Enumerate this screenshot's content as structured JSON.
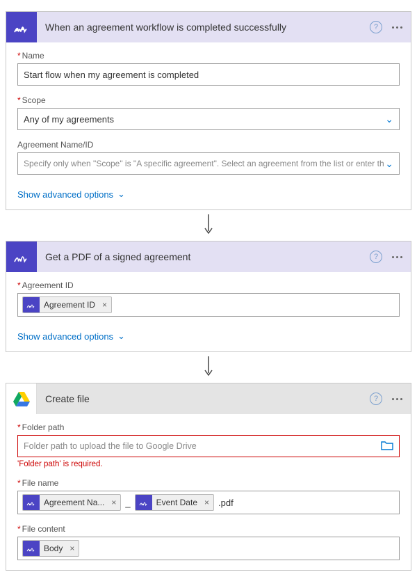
{
  "cards": {
    "trigger": {
      "title": "When an agreement workflow is completed successfully",
      "name": {
        "label": "Name",
        "value": "Start flow when my agreement is completed"
      },
      "scope": {
        "label": "Scope",
        "value": "Any of my agreements"
      },
      "agreement": {
        "label": "Agreement Name/ID",
        "placeholder": "Specify only when \"Scope\" is \"A specific agreement\". Select an agreement from the list or enter th"
      },
      "advanced": "Show advanced options"
    },
    "getpdf": {
      "title": "Get a PDF of a signed agreement",
      "agreementId": {
        "label": "Agreement ID",
        "token": "Agreement ID"
      },
      "advanced": "Show advanced options"
    },
    "createfile": {
      "title": "Create file",
      "folder": {
        "label": "Folder path",
        "placeholder": "Folder path to upload the file to Google Drive",
        "error": "'Folder path' is required."
      },
      "filename": {
        "label": "File name",
        "token1": "Agreement Na...",
        "token2": "Event Date",
        "suffix": ".pdf",
        "sep": "_"
      },
      "filecontent": {
        "label": "File content",
        "token": "Body"
      }
    }
  }
}
